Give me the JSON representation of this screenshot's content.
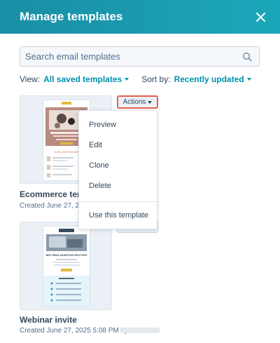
{
  "dialog": {
    "title": "Manage templates"
  },
  "search": {
    "placeholder": "Search email templates"
  },
  "filters": {
    "view_label": "View:",
    "view_value": "All saved templates",
    "sort_label": "Sort by:",
    "sort_value": "Recently updated"
  },
  "templates": [
    {
      "name": "Ecommerce tem",
      "meta": "Created June 27, 202",
      "actions_label": "Actions",
      "thumb_text": "OUR LATEST BOOKS"
    },
    {
      "name": "Webinar invite",
      "meta": "Created June 27, 2025 5:08 PM by",
      "thumb_heading": "BEST EMAIL MARKETING PRACTICES"
    }
  ],
  "actions_menu": {
    "items": [
      "Preview",
      "Edit",
      "Clone",
      "Delete"
    ],
    "extra": "Use this template"
  },
  "colors": {
    "header": "#1a8ea6",
    "accent": "#0091ae",
    "highlight": "#e8614f",
    "text": "#33475b"
  }
}
